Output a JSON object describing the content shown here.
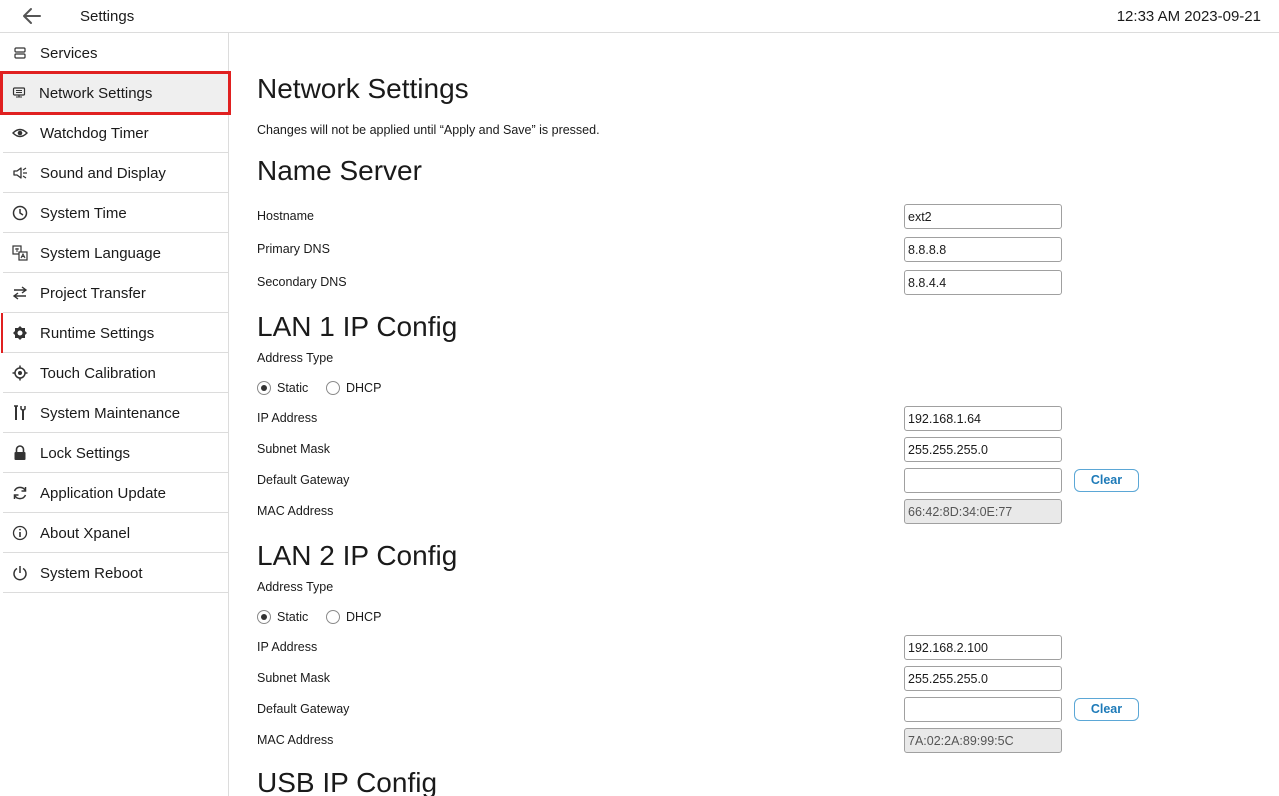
{
  "topbar": {
    "title": "Settings",
    "clock": "12:33 AM 2023-09-21"
  },
  "sidebar": {
    "items": [
      {
        "label": "Services",
        "icon": "services-icon"
      },
      {
        "label": "Network Settings",
        "icon": "network-icon"
      },
      {
        "label": "Watchdog Timer",
        "icon": "eye-icon"
      },
      {
        "label": "Sound and Display",
        "icon": "speaker-icon"
      },
      {
        "label": "System Time",
        "icon": "clock-icon"
      },
      {
        "label": "System Language",
        "icon": "translate-icon"
      },
      {
        "label": "Project Transfer",
        "icon": "transfer-arrows-icon"
      },
      {
        "label": "Runtime Settings",
        "icon": "runtime-gear-icon"
      },
      {
        "label": "Touch Calibration",
        "icon": "crosshair-icon"
      },
      {
        "label": "System Maintenance",
        "icon": "tools-icon"
      },
      {
        "label": "Lock Settings",
        "icon": "lock-icon"
      },
      {
        "label": "Application Update",
        "icon": "refresh-icon"
      },
      {
        "label": "About Xpanel",
        "icon": "info-icon"
      },
      {
        "label": "System Reboot",
        "icon": "power-icon"
      }
    ],
    "selected_index": 1
  },
  "main": {
    "title": "Network Settings",
    "note": "Changes will not be applied until “Apply and Save” is pressed.",
    "name_server": {
      "heading": "Name Server",
      "hostname_label": "Hostname",
      "hostname_value": "ext2",
      "primary_dns_label": "Primary DNS",
      "primary_dns_value": "8.8.8.8",
      "secondary_dns_label": "Secondary DNS",
      "secondary_dns_value": "8.8.4.4"
    },
    "lan1": {
      "heading": "LAN 1 IP Config",
      "address_type_label": "Address Type",
      "static_label": "Static",
      "dhcp_label": "DHCP",
      "address_type_selected": "Static",
      "ip_label": "IP Address",
      "ip_value": "192.168.1.64",
      "subnet_label": "Subnet Mask",
      "subnet_value": "255.255.255.0",
      "gateway_label": "Default Gateway",
      "gateway_value": "",
      "clear_label": "Clear",
      "mac_label": "MAC Address",
      "mac_value": "66:42:8D:34:0E:77"
    },
    "lan2": {
      "heading": "LAN 2 IP Config",
      "address_type_label": "Address Type",
      "static_label": "Static",
      "dhcp_label": "DHCP",
      "address_type_selected": "Static",
      "ip_label": "IP Address",
      "ip_value": "192.168.2.100",
      "subnet_label": "Subnet Mask",
      "subnet_value": "255.255.255.0",
      "gateway_label": "Default Gateway",
      "gateway_value": "",
      "clear_label": "Clear",
      "mac_label": "MAC Address",
      "mac_value": "7A:02:2A:89:99:5C"
    },
    "usb": {
      "heading": "USB IP Config"
    }
  },
  "colors": {
    "selection_outline": "#e02020",
    "clear_button_text": "#1d7ab8",
    "divider": "#dcdcdc"
  }
}
